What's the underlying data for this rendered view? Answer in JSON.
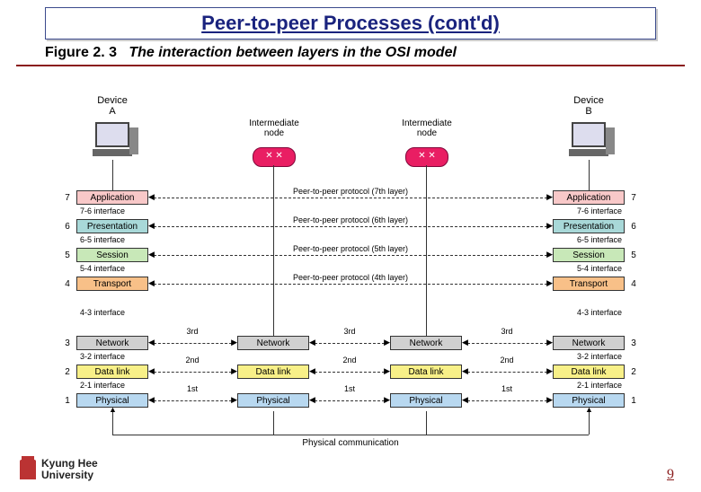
{
  "title": "Peer-to-peer Processes (cont'd)",
  "figure": {
    "label": "Figure 2. 3",
    "caption": "The interaction between layers in the OSI model"
  },
  "devices": {
    "a": "Device\nA",
    "b": "Device\nB"
  },
  "nodes": {
    "left": "Intermediate\nnode",
    "right": "Intermediate\nnode"
  },
  "layers": {
    "7": "Application",
    "6": "Presentation",
    "5": "Session",
    "4": "Transport",
    "3": "Network",
    "2": "Data link",
    "1": "Physical"
  },
  "interfaces": {
    "76": "7-6 interface",
    "65": "6-5 interface",
    "54": "5-4 interface",
    "43": "4-3 interface",
    "32": "3-2 interface",
    "21": "2-1 interface"
  },
  "protocols": {
    "7": "Peer-to-peer protocol (7th layer)",
    "6": "Peer-to-peer protocol (6th layer)",
    "5": "Peer-to-peer protocol (5th layer)",
    "4": "Peer-to-peer protocol (4th layer)"
  },
  "hops": {
    "3": "3rd",
    "2": "2nd",
    "1": "1st"
  },
  "physical": "Physical communication",
  "numbers": [
    "7",
    "6",
    "5",
    "4",
    "3",
    "2",
    "1"
  ],
  "footer": {
    "university": "Kyung Hee\nUniversity",
    "page": "9"
  }
}
